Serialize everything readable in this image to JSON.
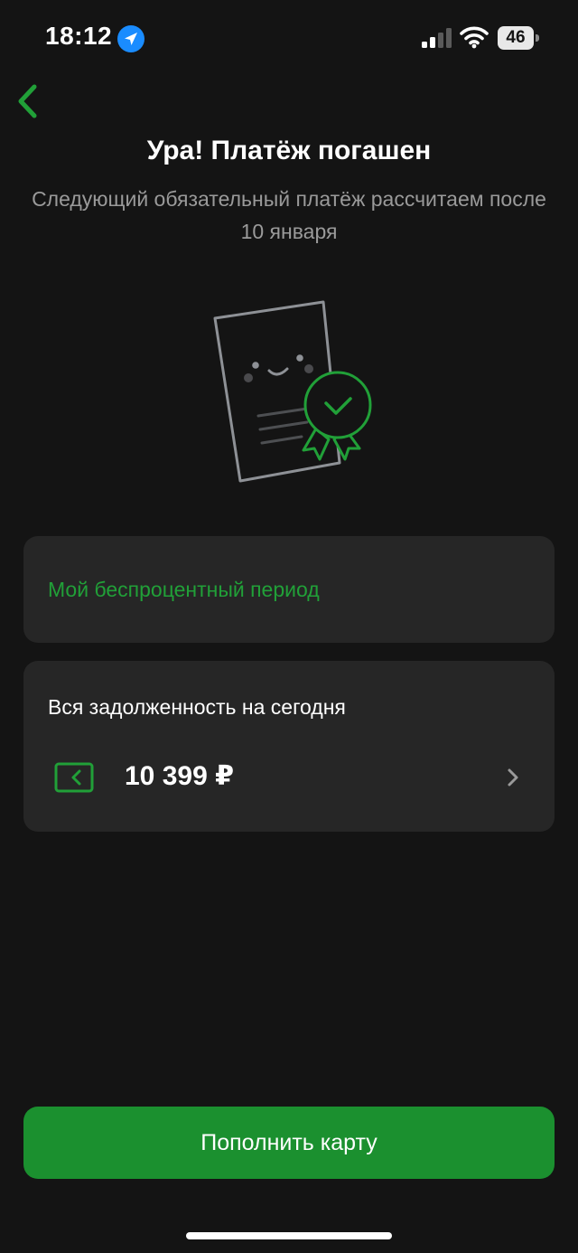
{
  "status_bar": {
    "time": "18:12",
    "battery_level": "46",
    "icons": [
      "location-arrow-icon",
      "signal-icon",
      "wifi-icon",
      "battery-icon"
    ]
  },
  "header": {
    "back_icon": "chevron-left-icon"
  },
  "main": {
    "title": "Ура! Платёж погашен",
    "subtitle": "Следующий обязательный платёж рассчитаем после 10 января",
    "illustration_icon": "document-with-seal-icon"
  },
  "grace_period_card": {
    "label": "Мой беспроцентный период"
  },
  "debt_card": {
    "label": "Вся задолженность на сегодня",
    "amount": "10 399 ₽",
    "icon": "card-icon",
    "chevron_icon": "chevron-right-icon"
  },
  "footer": {
    "topup_label": "Пополнить карту"
  },
  "colors": {
    "background": "#141414",
    "card_background": "#262626",
    "accent_green": "#21a038",
    "button_green": "#1b902f",
    "muted_text": "#9a9a9a"
  }
}
